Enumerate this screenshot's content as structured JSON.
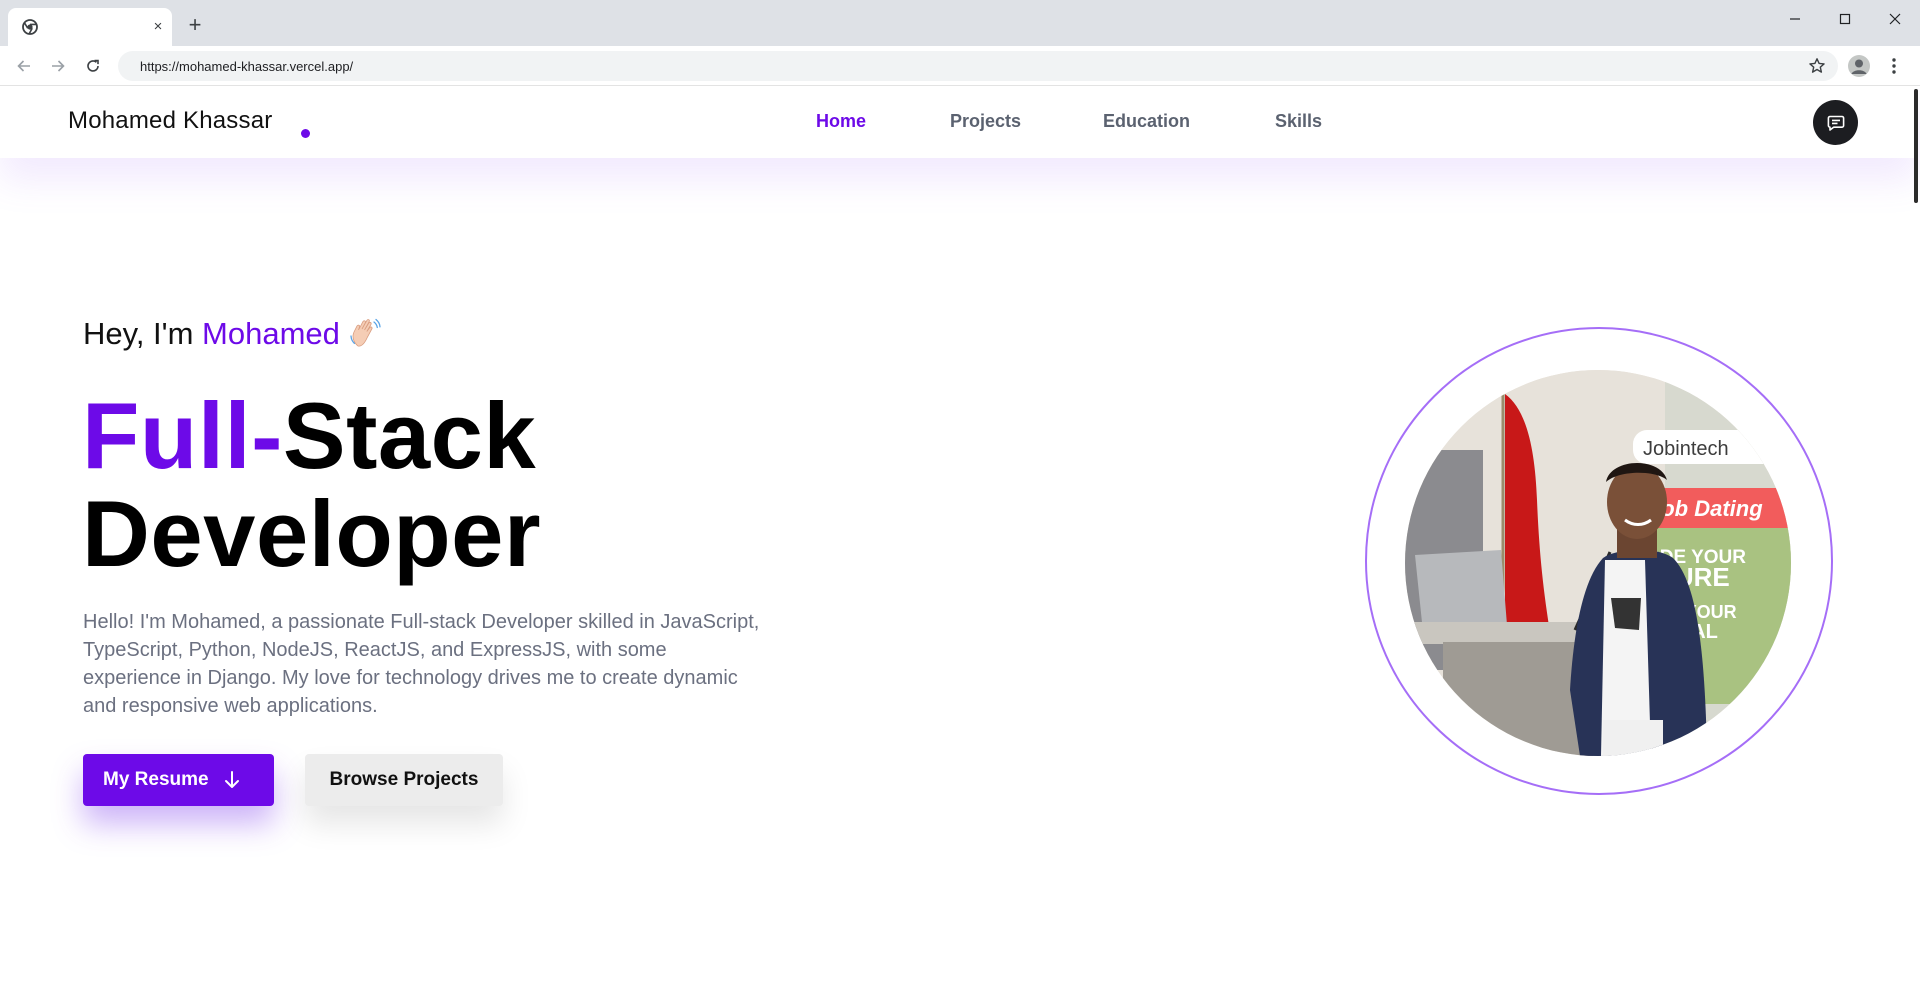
{
  "browser": {
    "tab_close": "×",
    "new_tab": "+",
    "url": "https://mohamed-khassar.vercel.app/"
  },
  "nav": {
    "brand": "Mohamed Khassar",
    "links": [
      {
        "label": "Home",
        "active": true
      },
      {
        "label": "Projects",
        "active": false
      },
      {
        "label": "Education",
        "active": false
      },
      {
        "label": "Skills",
        "active": false
      }
    ]
  },
  "hero": {
    "greeting_prefix": "Hey, I'm ",
    "greeting_name": "Mohamed",
    "headline_part1": "Full-",
    "headline_part2": "Stack",
    "headline_part3": "Developer",
    "intro": "Hello! I'm Mohamed, a passionate Full-stack Developer skilled in JavaScript, TypeScript, Python, NodeJS, ReactJS, and ExpressJS, with some experience in Django. My love for technology drives me to create dynamic and responsive web applications.",
    "resume_button": "My Resume",
    "browse_button": "Browse Projects"
  },
  "photo_signs": {
    "brand": "Jobintech",
    "event": "Job Dating",
    "line1": "ODE YOUR",
    "line2": "TURE",
    "line3": "K YOUR",
    "line4": "NTIAL"
  },
  "colors": {
    "accent": "#6d0ae8",
    "text": "#111111",
    "muted": "#6b7080",
    "nav_muted": "#5b6270"
  },
  "icons": {
    "tab_favicon": "chrome-icon",
    "back": "arrow-left-icon",
    "forward": "arrow-right-icon",
    "reload": "reload-icon",
    "bookmark": "star-icon",
    "profile": "profile-icon",
    "menu": "kebab-menu-icon",
    "chat": "chat-icon",
    "wave": "waving-hand-icon",
    "download": "arrow-down-icon"
  }
}
